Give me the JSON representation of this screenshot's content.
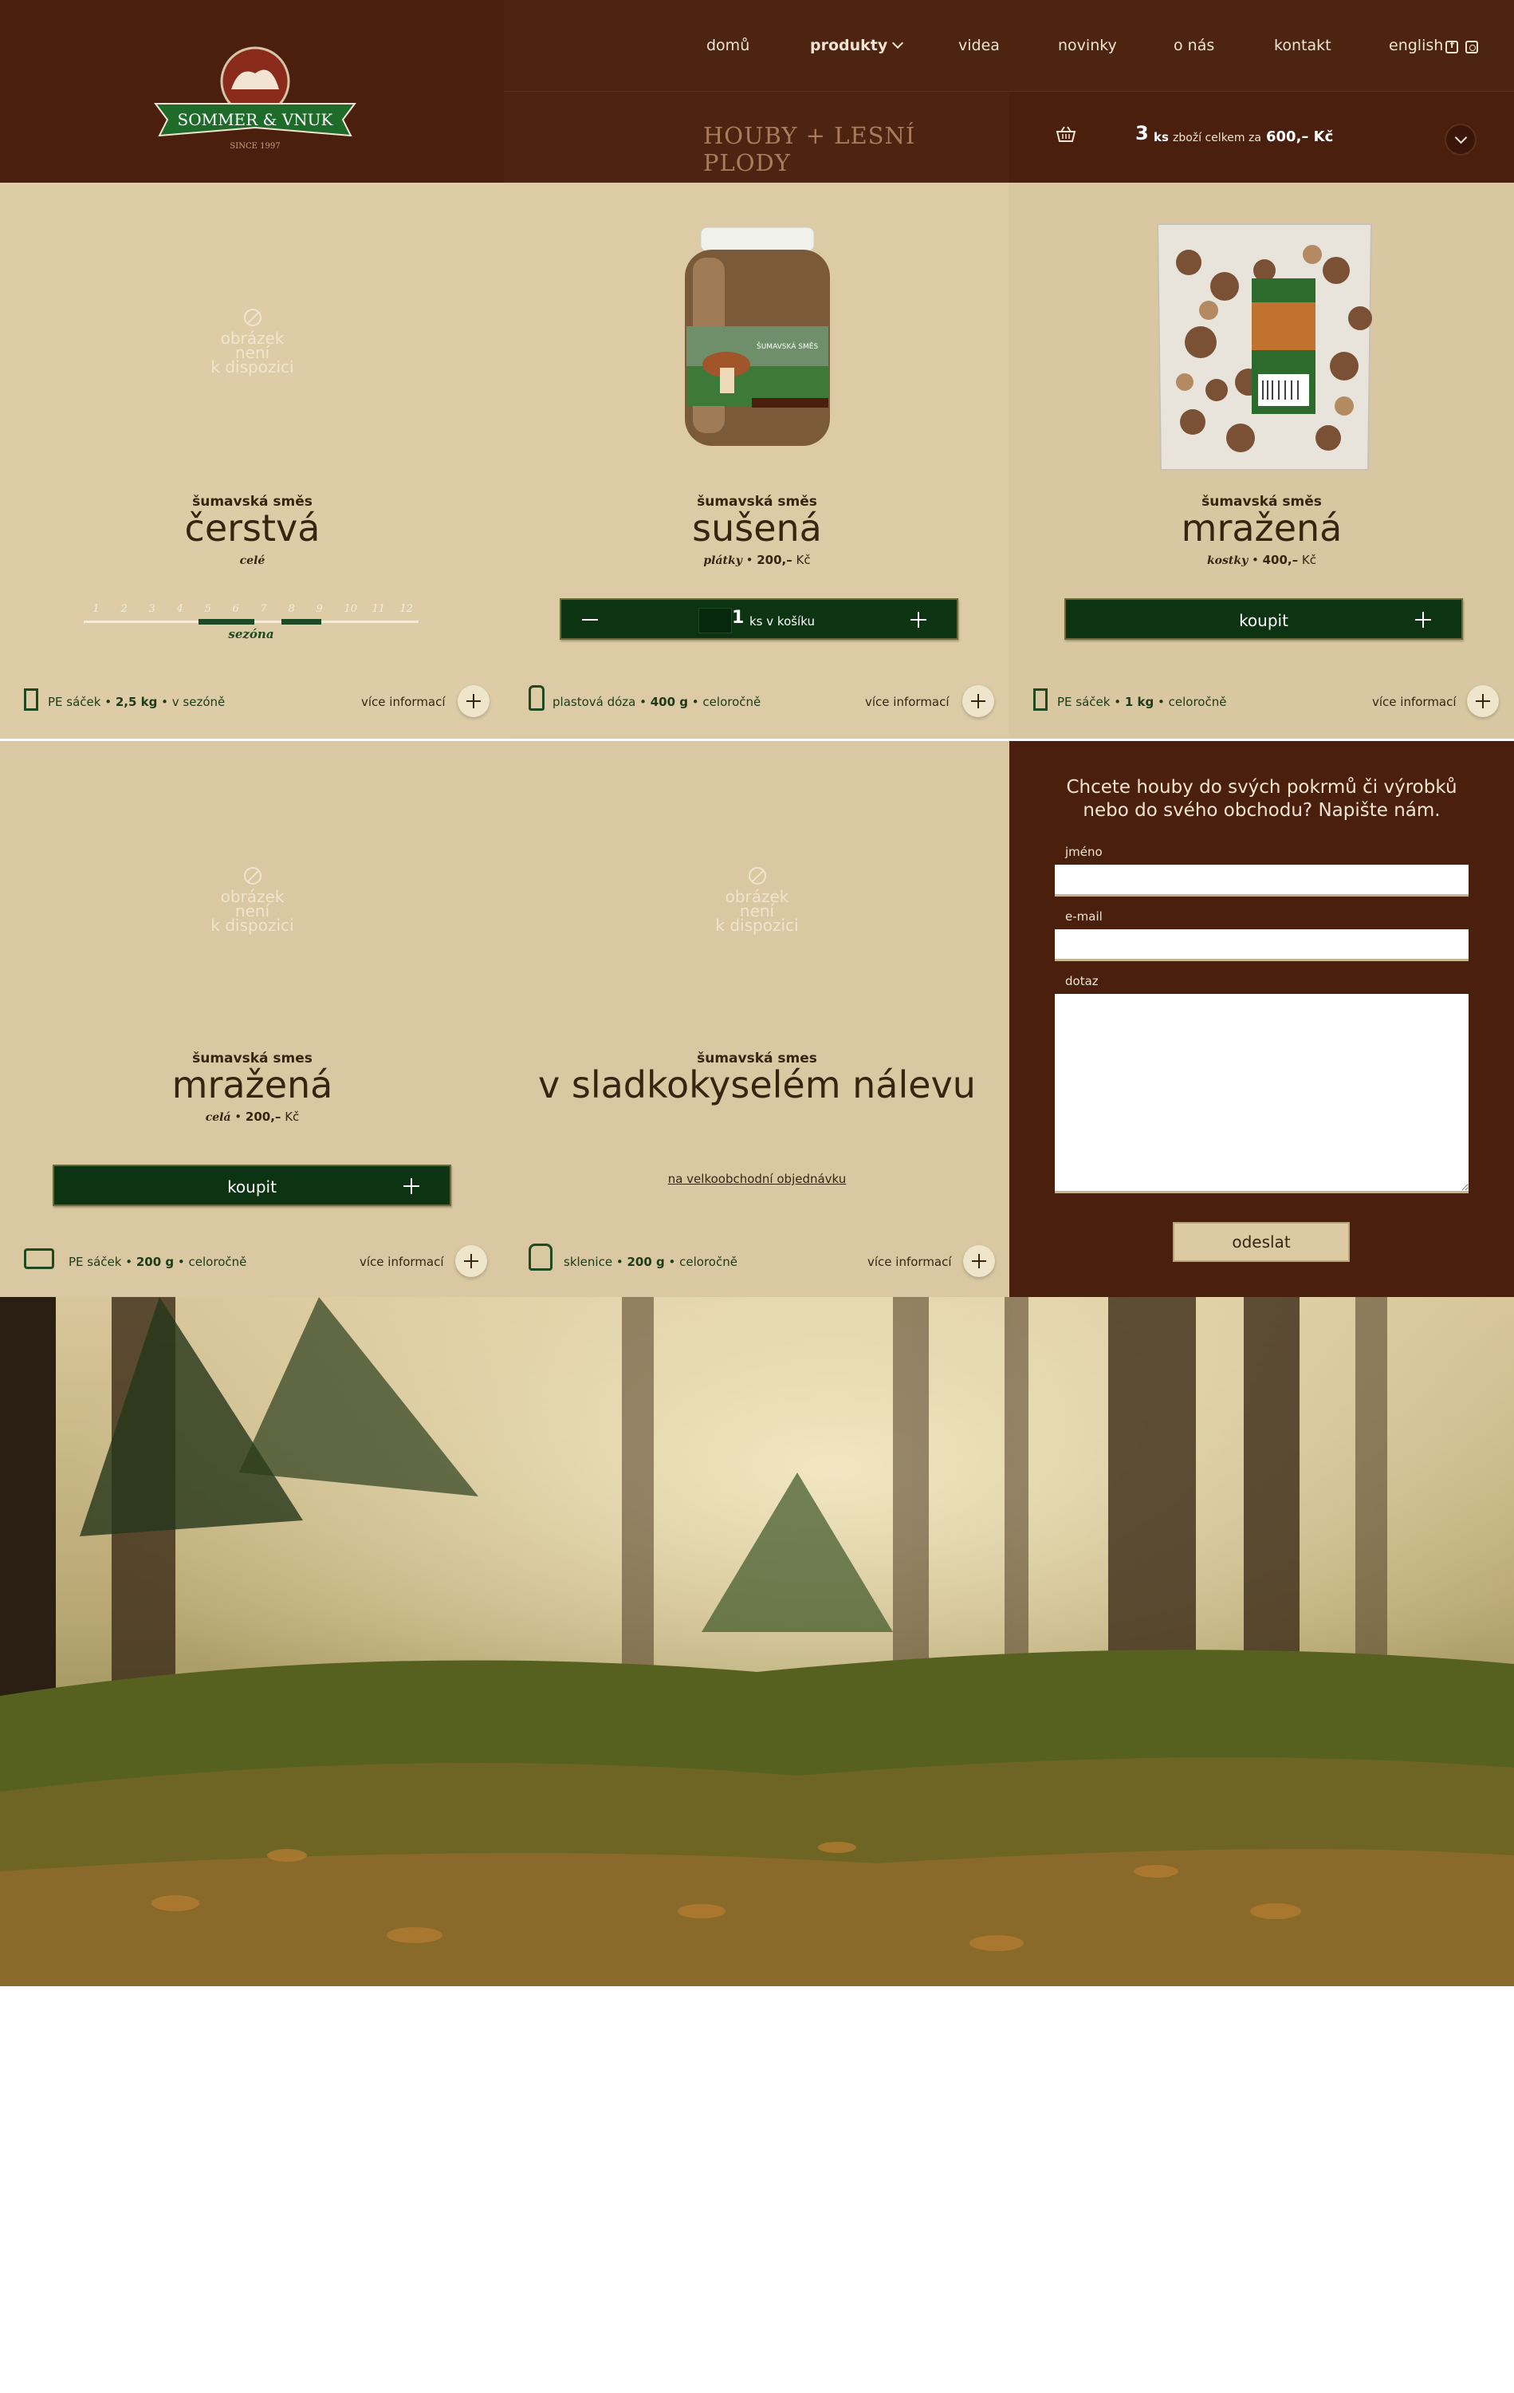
{
  "header": {
    "logo": {
      "brand": "SOMMER & VNUK",
      "tagline": "SINCE 1997"
    },
    "nav": {
      "home": "domů",
      "products": "produkty",
      "videos": "videa",
      "news": "novinky",
      "about": "o nás",
      "contact": "kontakt",
      "language": "english"
    },
    "category_title": "HOUBY + LESNÍ PLODY",
    "cart": {
      "count": "3",
      "count_unit": "ks",
      "text": "zboží celkem za",
      "total": "600,– Kč"
    }
  },
  "no_image": {
    "line1": "obrázek",
    "line2": "není",
    "line3": "k dispozici"
  },
  "products": [
    {
      "subtitle": "šumavská směs",
      "title": "čerstvá",
      "detail_italic": "celé",
      "season": {
        "months": [
          "1",
          "2",
          "3",
          "4",
          "5",
          "6",
          "7",
          "8",
          "9",
          "10",
          "11",
          "12"
        ],
        "label": "sezóna"
      },
      "package": {
        "type": "PE sáček",
        "weight": "2,5 kg",
        "availability": "v sezóně"
      },
      "more": "více informací"
    },
    {
      "subtitle": "šumavská směs",
      "title": "sušená",
      "detail_italic": "plátky",
      "price": "200,–",
      "currency": "Kč",
      "cart_qty": "1",
      "cart_qty_label": "ks v košíku",
      "jar_label": "ŠUMAVSKÁ SMĚS",
      "package": {
        "type": "plastová dóza",
        "weight": "400 g",
        "availability": "celoročně"
      },
      "more": "více informací"
    },
    {
      "subtitle": "šumavská směs",
      "title": "mražená",
      "detail_italic": "kostky",
      "price": "400,–",
      "currency": "Kč",
      "buy": "koupit",
      "package": {
        "type": "PE sáček",
        "weight": "1 kg",
        "availability": "celoročně"
      },
      "more": "více informací"
    },
    {
      "subtitle": "šumavská smes",
      "title": "mražená",
      "detail_italic": "celá",
      "price": "200,–",
      "currency": "Kč",
      "buy": "koupit",
      "package": {
        "type": "PE sáček",
        "weight": "200 g",
        "availability": "celoročně"
      },
      "more": "více informací"
    },
    {
      "subtitle": "šumavská smes",
      "title": "v sladkokyselém nálevu",
      "wholesale": "na velkoobchodní objednávku",
      "package": {
        "type": "sklenice",
        "weight": "200 g",
        "availability": "celoročně"
      },
      "more": "více informací"
    }
  ],
  "contact": {
    "title_line1": "Chcete houby do svých pokrmů či výrobků",
    "title_line2": "nebo do svého obchodu? Napište nám.",
    "name_label": "jméno",
    "email_label": "e-mail",
    "question_label": "dotaz",
    "submit": "odeslat"
  },
  "colors": {
    "header_brown": "#4a1f0e",
    "cream": "#ddcca6",
    "button_green": "#0c3412",
    "accent_gold": "#a97d5a"
  }
}
